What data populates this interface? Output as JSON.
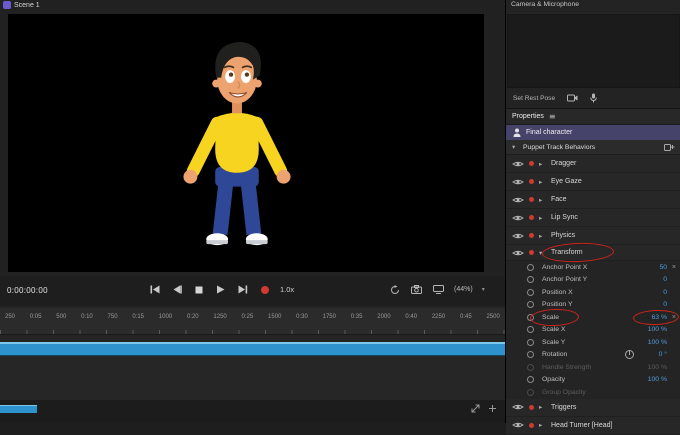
{
  "scene": {
    "tab_label": "Scene 1"
  },
  "transport": {
    "timecode": "0:00:00:00",
    "speed": "1.0x",
    "zoom": "(44%)"
  },
  "timeline": {
    "ruler_labels": [
      "250",
      "0:05",
      "500",
      "0:10",
      "750",
      "0:15",
      "1000",
      "0:20",
      "1250",
      "0:25",
      "1500",
      "0:30",
      "1750",
      "0:35",
      "2000",
      "0:40",
      "2250",
      "0:45",
      "2500"
    ]
  },
  "camera_mic": {
    "title": "Camera & Microphone",
    "set_rest_pose": "Set Rest Pose"
  },
  "properties": {
    "title": "Properties",
    "selected_item": "Final character",
    "section_title": "Puppet Track Behaviors",
    "behaviors": [
      {
        "label": "Dragger"
      },
      {
        "label": "Eye Gaze"
      },
      {
        "label": "Face"
      },
      {
        "label": "Lip Sync"
      },
      {
        "label": "Physics"
      },
      {
        "label": "Transform",
        "expanded": true
      },
      {
        "label": "Triggers"
      },
      {
        "label": "Head Turner [Head]"
      }
    ],
    "transform_params": [
      {
        "label": "Anchor Point X",
        "value": "50"
      },
      {
        "label": "Anchor Point Y",
        "value": "0"
      },
      {
        "label": "Position X",
        "value": "0"
      },
      {
        "label": "Position Y",
        "value": "0"
      },
      {
        "label": "Scale",
        "value": "63 %"
      },
      {
        "label": "Scale X",
        "value": "100 %"
      },
      {
        "label": "Scale Y",
        "value": "100 %"
      },
      {
        "label": "Rotation",
        "value": "0 °"
      },
      {
        "label": "Handle Strength",
        "value": "100 %"
      },
      {
        "label": "Opacity",
        "value": "100 %"
      },
      {
        "label": "Group Opacity",
        "value": ""
      }
    ]
  },
  "icons": {
    "chevron_collapsed": "▸",
    "chevron_expanded": "▾",
    "menu": "≡",
    "clear": "×",
    "caret_down": "▾"
  },
  "colors": {
    "accent_blue": "#4f9ee3",
    "timeline_bar": "#2e93cc",
    "record_red": "#cf3b30",
    "selection_purple": "#45436a",
    "annotation_red": "#e0251a"
  }
}
